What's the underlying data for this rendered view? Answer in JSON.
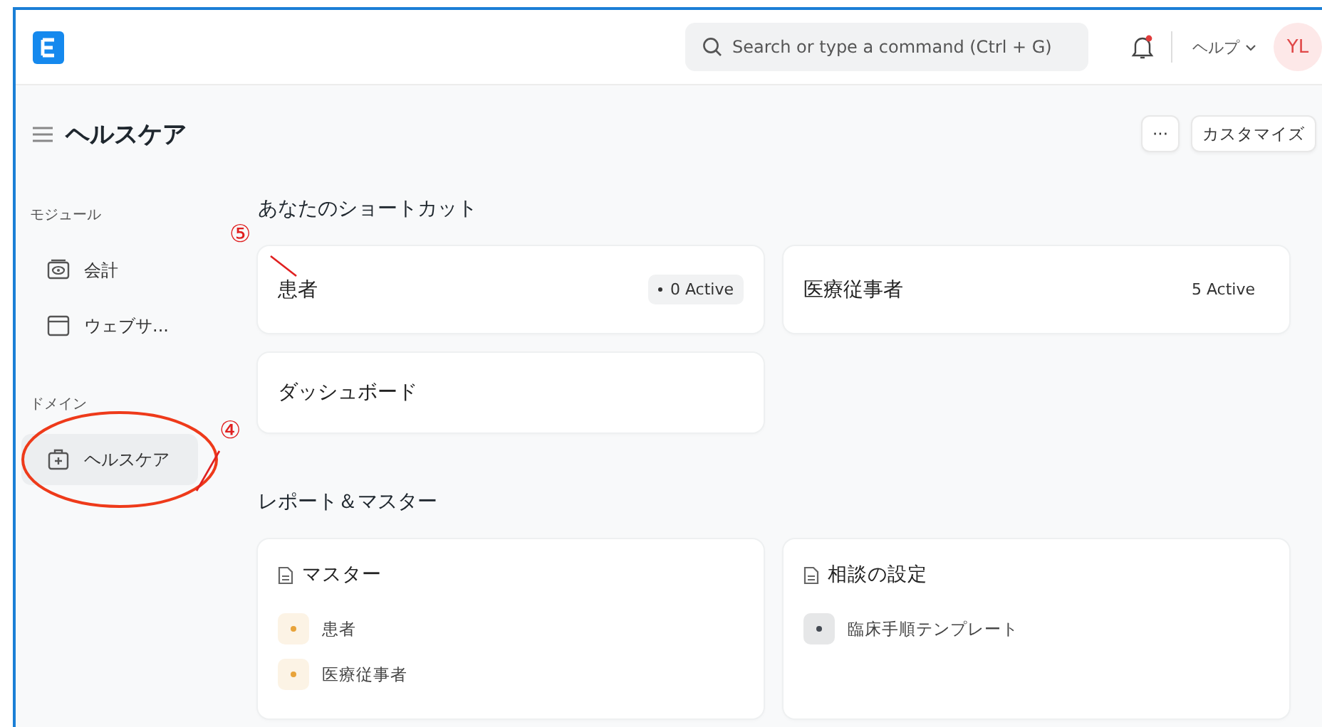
{
  "topbar": {
    "search": {
      "placeholder": "Search or type a command (Ctrl + G)"
    },
    "notifications": {
      "unread": true
    },
    "help": "ヘルプ",
    "avatar": "YL"
  },
  "page": {
    "title": "ヘルスケア",
    "buttons": [
      {
        "label": "···",
        "kind": "more"
      },
      {
        "label": "カスタマイズ",
        "kind": "text"
      }
    ]
  },
  "sidebar": {
    "sections": [
      {
        "label": "モジュール",
        "items": [
          {
            "label": "会計",
            "selected": false
          },
          {
            "label": "ウェブサ...",
            "selected": false
          }
        ]
      },
      {
        "label": "ドメイン",
        "items": [
          {
            "label": "ヘルスケア",
            "selected": true
          }
        ]
      }
    ]
  },
  "shortcuts": {
    "title": "あなたのショートカット",
    "items": [
      {
        "label": "患者",
        "count": "0 Active",
        "kind": "pill"
      },
      {
        "label": "医療従事者",
        "count": "5 Active",
        "kind": "plain"
      },
      {
        "label": "ダッシュボード"
      }
    ]
  },
  "reports": {
    "title": "レポート＆マスター",
    "cards": [
      {
        "title": "マスター",
        "links": [
          {
            "label": "患者",
            "color": "#e8a33a"
          },
          {
            "label": "医療従事者",
            "color": "#e8a33a"
          }
        ]
      },
      {
        "title": "相談の設定",
        "links": [
          {
            "label": "臨床手順テンプレート",
            "color": "#444a52"
          }
        ]
      }
    ]
  },
  "annotations": [
    {
      "label": "⑤",
      "kind": "shortcut"
    },
    {
      "label": "④",
      "kind": "sidebar"
    }
  ]
}
